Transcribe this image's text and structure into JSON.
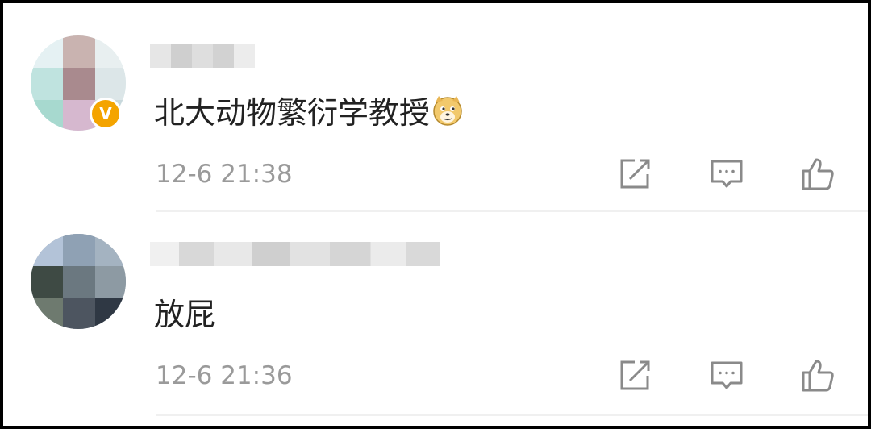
{
  "comments": [
    {
      "text": "北大动物繁衍学教授",
      "emoji": "doge-emoji",
      "time": "12-6 21:38",
      "verified": true,
      "verified_badge": "V"
    },
    {
      "text": "放屁",
      "time": "12-6 21:36",
      "verified": false
    }
  ],
  "actions": {
    "share_icon": "share-edit-icon",
    "reply_icon": "comment-icon",
    "like_icon": "thumbs-up-icon"
  },
  "colors": {
    "text": "#222222",
    "time": "#9a9a9a",
    "icon": "#8a8a8a",
    "badge": "#f4a400",
    "divider": "#f0f0f0"
  }
}
